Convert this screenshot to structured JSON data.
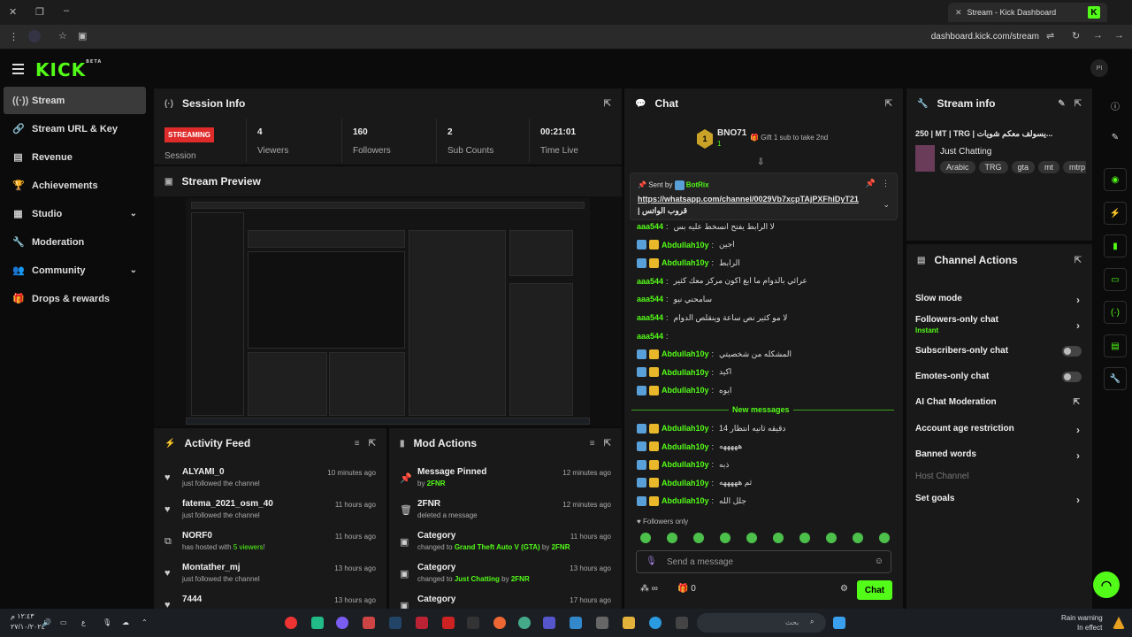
{
  "browser": {
    "tab_title": "Stream - Kick Dashboard",
    "url": "dashboard.kick.com/stream"
  },
  "app": {
    "logo": "KICK",
    "logo_sup": "BETA",
    "avatar": "PI"
  },
  "sidebar": {
    "items": [
      {
        "label": "Stream",
        "icon": "broadcast-icon"
      },
      {
        "label": "Stream URL & Key",
        "icon": "link-icon"
      },
      {
        "label": "Revenue",
        "icon": "revenue-icon"
      },
      {
        "label": "Achievements",
        "icon": "trophy-icon"
      },
      {
        "label": "Studio",
        "icon": "studio-icon"
      },
      {
        "label": "Moderation",
        "icon": "wrench-icon"
      },
      {
        "label": "Community",
        "icon": "community-icon"
      },
      {
        "label": "Drops & rewards",
        "icon": "gift-icon"
      }
    ]
  },
  "session": {
    "title": "Session Info",
    "status": "STREAMING",
    "status_label": "Session",
    "stats": [
      {
        "value": "4",
        "label": "Viewers"
      },
      {
        "value": "160",
        "label": "Followers"
      },
      {
        "value": "2",
        "label": "Sub Counts"
      },
      {
        "value": "00:21:01",
        "label": "Time Live"
      }
    ]
  },
  "preview": {
    "title": "Stream Preview"
  },
  "activity": {
    "title": "Activity Feed",
    "items": [
      {
        "name": "ALYAMI_0",
        "sub": "just followed the channel",
        "time": "10 minutes ago",
        "icon": "heart-icon"
      },
      {
        "name": "fatema_2021_osm_40",
        "sub": "just followed the channel",
        "time": "11 hours ago",
        "icon": "heart-icon"
      },
      {
        "name": "NORF0",
        "sub_pre": "has hosted with ",
        "sub_hl": "5 viewers",
        "sub_post": "!",
        "time": "11 hours ago",
        "icon": "host-icon"
      },
      {
        "name": "Montather_mj",
        "sub": "just followed the channel",
        "time": "13 hours ago",
        "icon": "heart-icon"
      },
      {
        "name": "7444",
        "time": "13 hours ago",
        "icon": "heart-icon"
      }
    ]
  },
  "mod": {
    "title": "Mod Actions",
    "items": [
      {
        "name": "Message Pinned",
        "sub_pre": "by ",
        "sub_hl": "2FNR",
        "time": "12 minutes ago",
        "icon": "pin-icon"
      },
      {
        "name": "2FNR",
        "sub": "deleted a message",
        "time": "12 minutes ago",
        "icon": "trash-icon"
      },
      {
        "name": "Category",
        "sub_pre": "changed to ",
        "sub_hl": "Grand Theft Auto V (GTA)",
        "sub_mid": " by ",
        "sub_hl2": "2FNR",
        "time": "11 hours ago",
        "icon": "category-icon"
      },
      {
        "name": "Category",
        "sub_pre": "changed to ",
        "sub_hl": "Just Chatting",
        "sub_mid": " by ",
        "sub_hl2": "2FNR",
        "time": "13 hours ago",
        "icon": "category-icon"
      },
      {
        "name": "Category",
        "time": "17 hours ago",
        "icon": "category-icon"
      }
    ]
  },
  "chat": {
    "title": "Chat",
    "top_gifter": "BNO71",
    "top_count": "1",
    "gift_text": "Gift 1 sub to take 2nd",
    "pinned_by": "Sent by",
    "pinned_user": "BotRix",
    "pinned_link": "https://whatsapp.com/channel/0029Vb7xcpTAjPXFhiDyT21",
    "pinned_sub": "| قروب الواتس",
    "messages": [
      {
        "user": "aaa544",
        "text": "لا الرابط يفتح انسخط عليه بس",
        "badges": "none"
      },
      {
        "user": "Abdullah10y",
        "text": "اجين",
        "badges": "both"
      },
      {
        "user": "Abdullah10y",
        "text": "الرابط",
        "badges": "both"
      },
      {
        "user": "aaa544",
        "text": "عرائي بالدوام ما ابغ اكون مركز معك كثير",
        "badges": "none"
      },
      {
        "user": "aaa544",
        "text": "سامحني نيو",
        "badges": "none"
      },
      {
        "user": "aaa544",
        "text": "لا مو كثير نص ساعة وينقلص الدوام",
        "badges": "none"
      },
      {
        "user": "aaa544",
        "text": "",
        "badges": "none"
      },
      {
        "user": "Abdullah10y",
        "text": "المشكله من شخصيتي",
        "badges": "both"
      },
      {
        "user": "Abdullah10y",
        "text": "اكيد",
        "badges": "both"
      },
      {
        "user": "Abdullah10y",
        "text": "ايوه",
        "badges": "both"
      }
    ],
    "new_label": "New messages",
    "new_messages": [
      {
        "user": "Abdullah10y",
        "text": "14 دقيقه ثانيه انتظار",
        "badges": "both"
      },
      {
        "user": "Abdullah10y",
        "text": "هههههه",
        "badges": "both"
      },
      {
        "user": "Abdullah10y",
        "text": "ذبه",
        "badges": "both"
      },
      {
        "user": "Abdullah10y",
        "text": "ثم هههههه",
        "badges": "both"
      },
      {
        "user": "Abdullah10y",
        "text": "جلل الله",
        "badges": "both"
      }
    ],
    "followers_only": "Followers only",
    "input_placeholder": "Send a message",
    "infinity": "∞",
    "count": "0",
    "send_label": "Chat"
  },
  "stream_info": {
    "title": "Stream info",
    "stream_title": "250 | MT | TRG | يسولف معكم شويات...",
    "category": "Just Chatting",
    "tags": [
      "Arabic",
      "TRG",
      "gta",
      "mt",
      "mtrp"
    ]
  },
  "channel_actions": {
    "title": "Channel Actions",
    "items": [
      {
        "label": "Slow mode",
        "control": "chevron"
      },
      {
        "label": "Followers-only chat",
        "sub": "Instant",
        "control": "chevron"
      },
      {
        "label": "Subscribers-only chat",
        "control": "toggle"
      },
      {
        "label": "Emotes-only chat",
        "control": "toggle"
      },
      {
        "label": "AI Chat Moderation",
        "control": "external"
      },
      {
        "label": "Account age restriction",
        "control": "chevron"
      },
      {
        "label": "Banned words",
        "control": "chevron"
      },
      {
        "label": "Host Channel",
        "control": "none",
        "disabled": true
      },
      {
        "label": "Set goals",
        "control": "chevron"
      }
    ]
  },
  "taskbar": {
    "time": "١٢:٤٣ م",
    "date": "٢٧/١٠/٢٠٢٤",
    "search_placeholder": "بحث",
    "weather_title": "Rain warning",
    "weather_sub": "In effect",
    "lang": "ع"
  },
  "colors": {
    "accent": "#53fc18",
    "live": "#e02b2b",
    "panel": "#191919"
  }
}
